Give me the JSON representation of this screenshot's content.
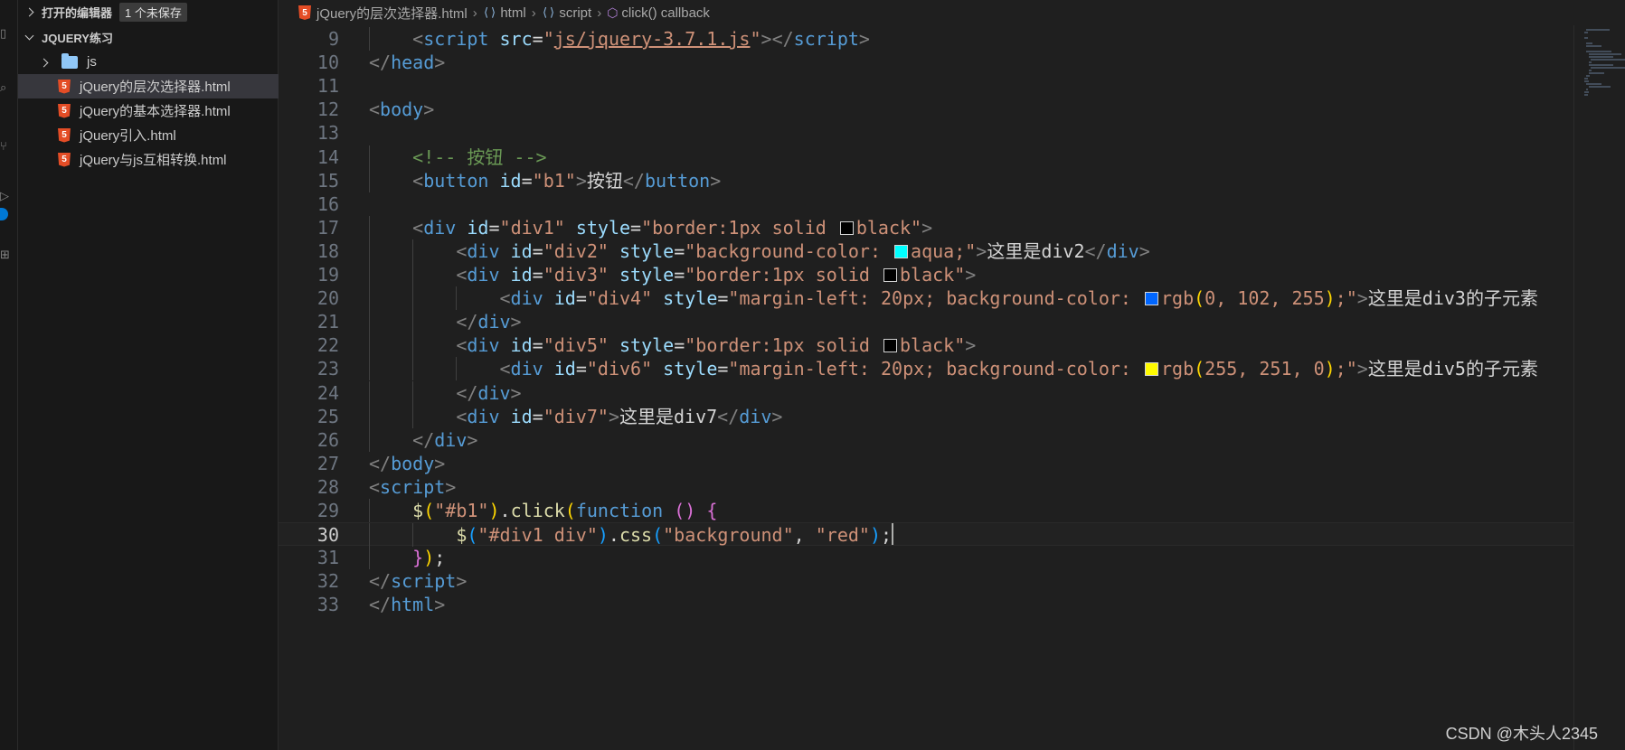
{
  "explorer": {
    "open_editors_label": "打开的编辑器",
    "unsaved_badge": "1 个未保存",
    "project_title": "JQUERY练习",
    "folder": "js",
    "files": [
      "jQuery的层次选择器.html",
      "jQuery的基本选择器.html",
      "jQuery引入.html",
      "jQuery与js互相转换.html"
    ],
    "selected_file": "jQuery的层次选择器.html"
  },
  "breadcrumb": {
    "file": "jQuery的层次选择器.html",
    "html": "html",
    "script": "script",
    "callback": "click() callback"
  },
  "editor": {
    "active_line": 30,
    "swatch_colors": {
      "black": "#000000",
      "aqua": "#00ffff",
      "blue": "#0066ff",
      "yellow": "#fffb00"
    },
    "lines": [
      {
        "n": "9",
        "tokens": [
          [
            "    ",
            ""
          ],
          [
            "<",
            "t-bracket"
          ],
          [
            "script",
            "t-tag"
          ],
          [
            " ",
            ""
          ],
          [
            "src",
            "t-attr"
          ],
          [
            "=",
            "t-punc"
          ],
          [
            "\"",
            "t-str"
          ],
          [
            "js/jquery-3.7.1.js",
            "t-str link"
          ],
          [
            "\"",
            "t-str"
          ],
          [
            "></",
            "t-bracket"
          ],
          [
            "script",
            "t-tag"
          ],
          [
            ">",
            "t-bracket"
          ]
        ]
      },
      {
        "n": "10",
        "tokens": [
          [
            "</",
            "t-bracket"
          ],
          [
            "head",
            "t-tag"
          ],
          [
            ">",
            "t-bracket"
          ]
        ]
      },
      {
        "n": "11",
        "tokens": []
      },
      {
        "n": "12",
        "tokens": [
          [
            "<",
            "t-bracket"
          ],
          [
            "body",
            "t-tag"
          ],
          [
            ">",
            "t-bracket"
          ]
        ]
      },
      {
        "n": "13",
        "tokens": []
      },
      {
        "n": "14",
        "tokens": [
          [
            "    ",
            ""
          ],
          [
            "<!-- 按钮 -->",
            "t-comment"
          ]
        ]
      },
      {
        "n": "15",
        "tokens": [
          [
            "    ",
            ""
          ],
          [
            "<",
            "t-bracket"
          ],
          [
            "button",
            "t-tag"
          ],
          [
            " ",
            ""
          ],
          [
            "id",
            "t-attr"
          ],
          [
            "=",
            "t-punc"
          ],
          [
            "\"b1\"",
            "t-str"
          ],
          [
            ">",
            "t-bracket"
          ],
          [
            "按钮",
            "t-text"
          ],
          [
            "</",
            "t-bracket"
          ],
          [
            "button",
            "t-tag"
          ],
          [
            ">",
            "t-bracket"
          ]
        ]
      },
      {
        "n": "16",
        "tokens": []
      },
      {
        "n": "17",
        "tokens": [
          [
            "    ",
            ""
          ],
          [
            "<",
            "t-bracket"
          ],
          [
            "div",
            "t-tag"
          ],
          [
            " ",
            ""
          ],
          [
            "id",
            "t-attr"
          ],
          [
            "=",
            "t-punc"
          ],
          [
            "\"div1\"",
            "t-str"
          ],
          [
            " ",
            ""
          ],
          [
            "style",
            "t-attr"
          ],
          [
            "=",
            "t-punc"
          ],
          [
            "\"border:1px solid ",
            "t-str"
          ],
          [
            "",
            "swatch:black"
          ],
          [
            "black\"",
            "t-str"
          ],
          [
            ">",
            "t-bracket"
          ]
        ]
      },
      {
        "n": "18",
        "tokens": [
          [
            "        ",
            ""
          ],
          [
            "<",
            "t-bracket"
          ],
          [
            "div",
            "t-tag"
          ],
          [
            " ",
            ""
          ],
          [
            "id",
            "t-attr"
          ],
          [
            "=",
            "t-punc"
          ],
          [
            "\"div2\"",
            "t-str"
          ],
          [
            " ",
            ""
          ],
          [
            "style",
            "t-attr"
          ],
          [
            "=",
            "t-punc"
          ],
          [
            "\"background-color: ",
            "t-str"
          ],
          [
            "",
            "swatch:aqua"
          ],
          [
            "aqua;\"",
            "t-str"
          ],
          [
            ">",
            "t-bracket"
          ],
          [
            "这里是div2",
            "t-text"
          ],
          [
            "</",
            "t-bracket"
          ],
          [
            "div",
            "t-tag"
          ],
          [
            ">",
            "t-bracket"
          ]
        ]
      },
      {
        "n": "19",
        "tokens": [
          [
            "        ",
            ""
          ],
          [
            "<",
            "t-bracket"
          ],
          [
            "div",
            "t-tag"
          ],
          [
            " ",
            ""
          ],
          [
            "id",
            "t-attr"
          ],
          [
            "=",
            "t-punc"
          ],
          [
            "\"div3\"",
            "t-str"
          ],
          [
            " ",
            ""
          ],
          [
            "style",
            "t-attr"
          ],
          [
            "=",
            "t-punc"
          ],
          [
            "\"border:1px solid ",
            "t-str"
          ],
          [
            "",
            "swatch:black"
          ],
          [
            "black\"",
            "t-str"
          ],
          [
            ">",
            "t-bracket"
          ]
        ]
      },
      {
        "n": "20",
        "tokens": [
          [
            "            ",
            ""
          ],
          [
            "<",
            "t-bracket"
          ],
          [
            "div",
            "t-tag"
          ],
          [
            " ",
            ""
          ],
          [
            "id",
            "t-attr"
          ],
          [
            "=",
            "t-punc"
          ],
          [
            "\"div4\"",
            "t-str"
          ],
          [
            " ",
            ""
          ],
          [
            "style",
            "t-attr"
          ],
          [
            "=",
            "t-punc"
          ],
          [
            "\"margin-left: 20px; background-color: ",
            "t-str"
          ],
          [
            "",
            "swatch:blue"
          ],
          [
            "rgb",
            "t-str"
          ],
          [
            "(",
            "b1"
          ],
          [
            "0, 102, 255",
            "t-str"
          ],
          [
            ")",
            "b1"
          ],
          [
            ";\"",
            "t-str"
          ],
          [
            ">",
            "t-bracket"
          ],
          [
            "这里是div3的子元素",
            "t-text"
          ]
        ]
      },
      {
        "n": "21",
        "tokens": [
          [
            "        ",
            ""
          ],
          [
            "</",
            "t-bracket"
          ],
          [
            "div",
            "t-tag"
          ],
          [
            ">",
            "t-bracket"
          ]
        ]
      },
      {
        "n": "22",
        "tokens": [
          [
            "        ",
            ""
          ],
          [
            "<",
            "t-bracket"
          ],
          [
            "div",
            "t-tag"
          ],
          [
            " ",
            ""
          ],
          [
            "id",
            "t-attr"
          ],
          [
            "=",
            "t-punc"
          ],
          [
            "\"div5\"",
            "t-str"
          ],
          [
            " ",
            ""
          ],
          [
            "style",
            "t-attr"
          ],
          [
            "=",
            "t-punc"
          ],
          [
            "\"border:1px solid ",
            "t-str"
          ],
          [
            "",
            "swatch:black"
          ],
          [
            "black\"",
            "t-str"
          ],
          [
            ">",
            "t-bracket"
          ]
        ]
      },
      {
        "n": "23",
        "tokens": [
          [
            "            ",
            ""
          ],
          [
            "<",
            "t-bracket"
          ],
          [
            "div",
            "t-tag"
          ],
          [
            " ",
            ""
          ],
          [
            "id",
            "t-attr"
          ],
          [
            "=",
            "t-punc"
          ],
          [
            "\"div6\"",
            "t-str"
          ],
          [
            " ",
            ""
          ],
          [
            "style",
            "t-attr"
          ],
          [
            "=",
            "t-punc"
          ],
          [
            "\"margin-left: 20px; background-color: ",
            "t-str"
          ],
          [
            "",
            "swatch:yellow"
          ],
          [
            "rgb",
            "t-str"
          ],
          [
            "(",
            "b1"
          ],
          [
            "255, 251, 0",
            "t-str"
          ],
          [
            ")",
            "b1"
          ],
          [
            ";\"",
            "t-str"
          ],
          [
            ">",
            "t-bracket"
          ],
          [
            "这里是div5的子元素",
            "t-text"
          ]
        ]
      },
      {
        "n": "24",
        "tokens": [
          [
            "        ",
            ""
          ],
          [
            "</",
            "t-bracket"
          ],
          [
            "div",
            "t-tag"
          ],
          [
            ">",
            "t-bracket"
          ]
        ]
      },
      {
        "n": "25",
        "tokens": [
          [
            "        ",
            ""
          ],
          [
            "<",
            "t-bracket"
          ],
          [
            "div",
            "t-tag"
          ],
          [
            " ",
            ""
          ],
          [
            "id",
            "t-attr"
          ],
          [
            "=",
            "t-punc"
          ],
          [
            "\"div7\"",
            "t-str"
          ],
          [
            ">",
            "t-bracket"
          ],
          [
            "这里是div7",
            "t-text"
          ],
          [
            "</",
            "t-bracket"
          ],
          [
            "div",
            "t-tag"
          ],
          [
            ">",
            "t-bracket"
          ]
        ]
      },
      {
        "n": "26",
        "tokens": [
          [
            "    ",
            ""
          ],
          [
            "</",
            "t-bracket"
          ],
          [
            "div",
            "t-tag"
          ],
          [
            ">",
            "t-bracket"
          ]
        ]
      },
      {
        "n": "27",
        "tokens": [
          [
            "</",
            "t-bracket"
          ],
          [
            "body",
            "t-tag"
          ],
          [
            ">",
            "t-bracket"
          ]
        ]
      },
      {
        "n": "28",
        "tokens": [
          [
            "<",
            "t-bracket"
          ],
          [
            "script",
            "t-tag"
          ],
          [
            ">",
            "t-bracket"
          ]
        ]
      },
      {
        "n": "29",
        "tokens": [
          [
            "    ",
            ""
          ],
          [
            "$",
            "t-fn"
          ],
          [
            "(",
            "b1"
          ],
          [
            "\"#b1\"",
            "t-str"
          ],
          [
            ")",
            "b1"
          ],
          [
            ".",
            "t-punc"
          ],
          [
            "click",
            "t-fn"
          ],
          [
            "(",
            "b1"
          ],
          [
            "function",
            "t-kw"
          ],
          [
            " ",
            ""
          ],
          [
            "()",
            "b2"
          ],
          [
            " ",
            ""
          ],
          [
            "{",
            "b2"
          ]
        ]
      },
      {
        "n": "30",
        "tokens": [
          [
            "        ",
            ""
          ],
          [
            "$",
            "t-fn"
          ],
          [
            "(",
            "b3"
          ],
          [
            "\"#div1 div\"",
            "t-str"
          ],
          [
            ")",
            "b3"
          ],
          [
            ".",
            "t-punc"
          ],
          [
            "css",
            "t-fn"
          ],
          [
            "(",
            "b3"
          ],
          [
            "\"background\"",
            "t-str"
          ],
          [
            ", ",
            "t-punc"
          ],
          [
            "\"red\"",
            "t-str"
          ],
          [
            ")",
            "b3"
          ],
          [
            ";",
            "t-punc"
          ],
          [
            "",
            "cursor"
          ]
        ]
      },
      {
        "n": "31",
        "tokens": [
          [
            "    ",
            ""
          ],
          [
            "}",
            "b2"
          ],
          [
            ")",
            "b1"
          ],
          [
            ";",
            "t-punc"
          ]
        ]
      },
      {
        "n": "32",
        "tokens": [
          [
            "</",
            "t-bracket"
          ],
          [
            "script",
            "t-tag"
          ],
          [
            ">",
            "t-bracket"
          ]
        ]
      },
      {
        "n": "33",
        "tokens": [
          [
            "</",
            "t-bracket"
          ],
          [
            "html",
            "t-tag"
          ],
          [
            ">",
            "t-bracket"
          ]
        ]
      }
    ]
  },
  "watermark": "CSDN @木头人2345"
}
